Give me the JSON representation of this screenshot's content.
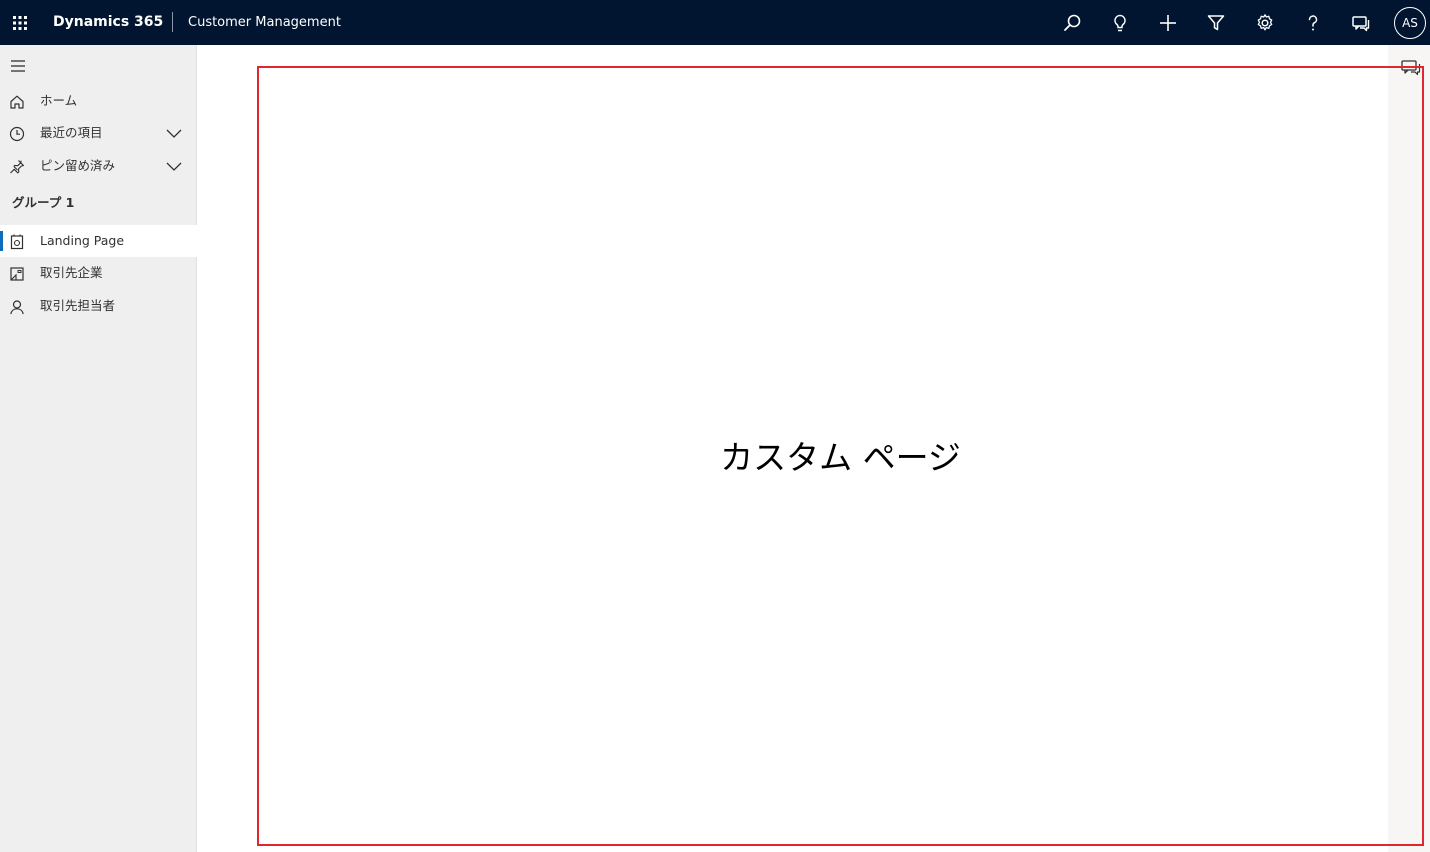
{
  "header": {
    "app_name": "Dynamics 365",
    "module_name": "Customer Management",
    "icons": [
      "waffle-icon",
      "search-icon",
      "lightbulb-icon",
      "plus-icon",
      "filter-icon",
      "gear-icon",
      "help-icon",
      "chat-icon"
    ],
    "user_initials": "AS",
    "background_color": "#011530"
  },
  "sidebar": {
    "nav": [
      {
        "label": "ホーム",
        "icon": "home-icon"
      },
      {
        "label": "最近の項目",
        "icon": "clock-icon",
        "expandable": true
      },
      {
        "label": "ピン留め済み",
        "icon": "pin-icon",
        "expandable": true
      }
    ],
    "group_title": "グループ 1",
    "items": [
      {
        "label": "Landing Page",
        "icon": "page-icon",
        "selected": true
      },
      {
        "label": "取引先企業",
        "icon": "account-icon",
        "selected": false
      },
      {
        "label": "取引先担当者",
        "icon": "contact-icon",
        "selected": false
      }
    ],
    "accent_color": "#0f6cbd"
  },
  "main": {
    "custom_page_title": "カスタム ページ",
    "frame_color": "#e0262e"
  }
}
